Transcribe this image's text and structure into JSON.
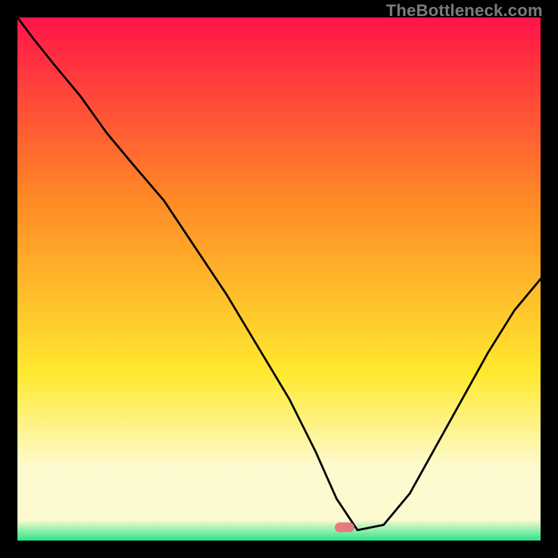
{
  "watermark": "TheBottleneck.com",
  "colors": {
    "background": "#000000",
    "gradient_top": "#ff1448",
    "gradient_mid1": "#ff8a26",
    "gradient_mid2": "#ffe92f",
    "gradient_yellow_band": "#fefad0",
    "gradient_green": "#2be58a",
    "curve": "#000000",
    "marker": "#e77a81",
    "watermark_text": "#7a7a7a"
  },
  "marker": {
    "x_frac": 0.625,
    "y_frac": 0.975
  },
  "chart_data": {
    "type": "line",
    "title": "",
    "xlabel": "",
    "ylabel": "",
    "xlim": [
      0,
      1
    ],
    "ylim": [
      0,
      1
    ],
    "series": [
      {
        "name": "bottleneck-curve",
        "x": [
          0.0,
          0.03,
          0.07,
          0.12,
          0.17,
          0.22,
          0.28,
          0.34,
          0.4,
          0.46,
          0.52,
          0.57,
          0.61,
          0.65,
          0.7,
          0.75,
          0.8,
          0.85,
          0.9,
          0.95,
          1.0
        ],
        "values": [
          1.0,
          0.96,
          0.91,
          0.85,
          0.78,
          0.72,
          0.65,
          0.56,
          0.47,
          0.37,
          0.27,
          0.17,
          0.08,
          0.02,
          0.03,
          0.09,
          0.18,
          0.27,
          0.36,
          0.44,
          0.5
        ]
      }
    ],
    "annotations": [
      {
        "type": "marker",
        "x": 0.625,
        "y": 0.025,
        "label": "optimal-point"
      }
    ]
  }
}
